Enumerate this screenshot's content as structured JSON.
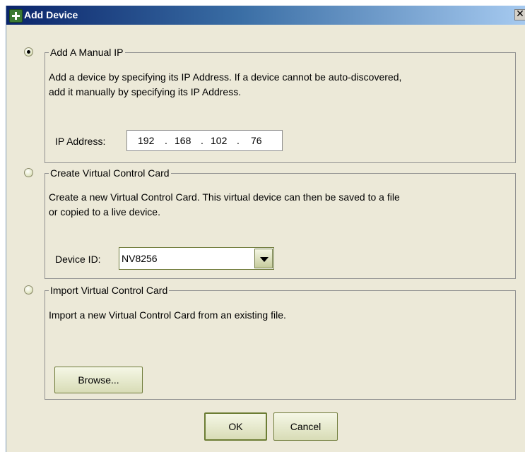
{
  "window": {
    "title": "Add Device",
    "close_glyph": "✕",
    "icon": "plus-icon"
  },
  "options": {
    "manual_ip": {
      "legend": "Add A Manual IP",
      "selected": true,
      "description_line1": "Add a device by specifying its IP Address. If a device cannot be auto-discovered,",
      "description_line2": "add it manually by specifying its IP Address.",
      "ip_label": "IP Address:",
      "ip_octets": [
        "192",
        "168",
        "102",
        "76"
      ],
      "ip_separator": "."
    },
    "virtual_card": {
      "legend": "Create Virtual Control Card",
      "selected": false,
      "description_line1": "Create a new Virtual Control Card. This virtual device can then be saved to a file",
      "description_line2": "or copied to a live device.",
      "device_id_label": "Device ID:",
      "device_id_value": "NV8256"
    },
    "import_card": {
      "legend": "Import Virtual Control Card",
      "selected": false,
      "description": "Import a new Virtual Control Card from an existing file.",
      "browse_label": "Browse..."
    }
  },
  "footer": {
    "ok_label": "OK",
    "cancel_label": "Cancel"
  },
  "colors": {
    "title_bar_start": "#0a246a",
    "title_bar_end": "#a6caf0",
    "dialog_background": "#ECE9D8",
    "button_border": "#6f7b3a"
  }
}
